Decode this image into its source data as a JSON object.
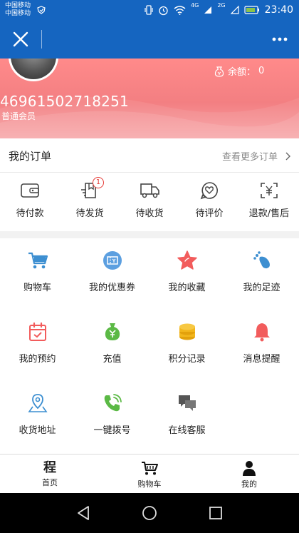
{
  "status_bar": {
    "carrier_line1": "中国移动",
    "carrier_line2": "中国移动",
    "network_4g": "4G",
    "network_2g": "2G",
    "time": "23:40"
  },
  "nav": {
    "close_icon": "close-icon",
    "more_icon": "more-icon"
  },
  "profile": {
    "balance_label": "余额：",
    "balance_value": "0",
    "user_id": "46961502718251",
    "level": "普通会员"
  },
  "orders": {
    "title": "我的订单",
    "more_label": "查看更多订单",
    "items": [
      {
        "label": "待付款",
        "icon": "wallet-icon"
      },
      {
        "label": "待发货",
        "icon": "ship-icon",
        "badge": "1"
      },
      {
        "label": "待收货",
        "icon": "truck-icon"
      },
      {
        "label": "待评价",
        "icon": "review-icon"
      },
      {
        "label": "退款/售后",
        "icon": "refund-icon"
      }
    ]
  },
  "features": [
    {
      "label": "购物车",
      "icon": "cart-icon"
    },
    {
      "label": "我的优惠券",
      "icon": "coupon-icon"
    },
    {
      "label": "我的收藏",
      "icon": "star-icon"
    },
    {
      "label": "我的足迹",
      "icon": "footprint-icon"
    },
    {
      "label": "我的预约",
      "icon": "calendar-icon"
    },
    {
      "label": "充值",
      "icon": "money-bag-icon"
    },
    {
      "label": "积分记录",
      "icon": "coins-icon"
    },
    {
      "label": "消息提醒",
      "icon": "bell-icon"
    },
    {
      "label": "收货地址",
      "icon": "map-pin-icon"
    },
    {
      "label": "一键拨号",
      "icon": "phone-icon"
    },
    {
      "label": "在线客服",
      "icon": "chat-icon"
    }
  ],
  "tabbar": {
    "items": [
      {
        "label": "首页",
        "glyph": "程"
      },
      {
        "label": "购物车"
      },
      {
        "label": "我的"
      }
    ]
  },
  "colors": {
    "nav_blue": "#1565c0",
    "header_pink": "#f37f82",
    "badge_red": "#e53935"
  }
}
